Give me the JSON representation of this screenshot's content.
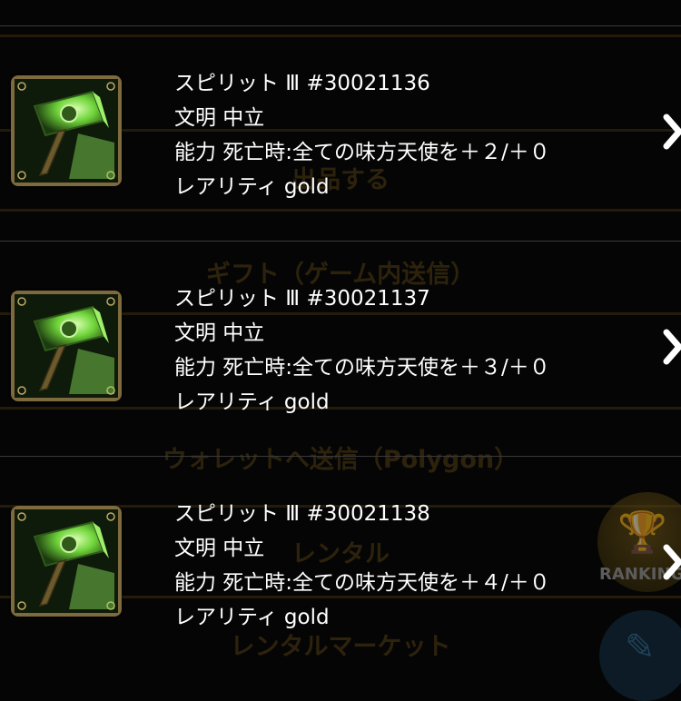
{
  "background_menu": {
    "items": [
      "出品する",
      "ギフト（ゲーム内送信）",
      "ウォレットへ送信（Polygon）",
      "レンタル",
      "レンタルマーケット"
    ],
    "ranking_label": "RANKING",
    "accent_color": "#7a5a15"
  },
  "items": [
    {
      "name": "スピリット Ⅲ #30021136",
      "civilization": "文明 中立",
      "ability": "能力 死亡時:全ての味方天使を＋２/＋０",
      "rarity": "レアリティ gold",
      "icon": "green-hammer-icon"
    },
    {
      "name": "スピリット Ⅲ #30021137",
      "civilization": "文明 中立",
      "ability": "能力 死亡時:全ての味方天使を＋３/＋０",
      "rarity": "レアリティ gold",
      "icon": "green-hammer-icon"
    },
    {
      "name": "スピリット Ⅲ #30021138",
      "civilization": "文明 中立",
      "ability": "能力 死亡時:全ての味方天使を＋４/＋０",
      "rarity": "レアリティ gold",
      "icon": "green-hammer-icon"
    }
  ]
}
